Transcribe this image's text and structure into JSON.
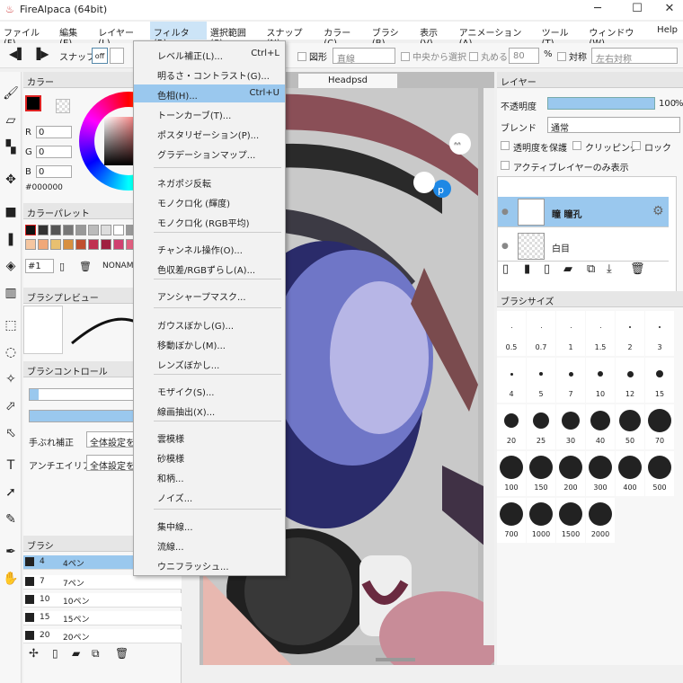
{
  "window": {
    "title": "FireAlpaca (64bit)",
    "min": "─",
    "max": "☐",
    "close": "✕"
  },
  "menubar": [
    "ファイル(F)",
    "編集(E)",
    "レイヤー(L)",
    "フィルタ(R)",
    "選択範囲(S)",
    "スナップ(N)",
    "カラー(C)",
    "ブラシ(B)",
    "表示(V)",
    "アニメーション(A)",
    "ツール(T)",
    "ウィンドウ(W)",
    "Help"
  ],
  "toolbar": {
    "snap": "スナップ",
    "off": "off",
    "shape_label": "図形",
    "shape_value": "直線",
    "center_label": "中央から選択",
    "round_label": "丸める",
    "round_value": "80",
    "percent": "%",
    "symmetry_label": "対称",
    "symmetry_value": "左右対称"
  },
  "filter_menu": [
    {
      "label": "レベル補正(L)...",
      "shortcut": "Ctrl+L"
    },
    {
      "label": "明るさ・コントラスト(G)...",
      "shortcut": ""
    },
    {
      "label": "色相(H)...",
      "shortcut": "Ctrl+U"
    },
    {
      "label": "トーンカーブ(T)...",
      "shortcut": ""
    },
    {
      "label": "ポスタリゼーション(P)...",
      "shortcut": ""
    },
    {
      "label": "グラデーションマップ...",
      "shortcut": ""
    },
    {
      "label": "ネガポジ反転",
      "shortcut": ""
    },
    {
      "label": "モノクロ化 (輝度)",
      "shortcut": ""
    },
    {
      "label": "モノクロ化 (RGB平均)",
      "shortcut": ""
    },
    {
      "label": "チャンネル操作(O)...",
      "shortcut": ""
    },
    {
      "label": "色収差/RGBずらし(A)...",
      "shortcut": ""
    },
    {
      "label": "アンシャープマスク...",
      "shortcut": ""
    },
    {
      "label": "ガウスぼかし(G)...",
      "shortcut": ""
    },
    {
      "label": "移動ぼかし(M)...",
      "shortcut": ""
    },
    {
      "label": "レンズぼかし...",
      "shortcut": ""
    },
    {
      "label": "モザイク(S)...",
      "shortcut": ""
    },
    {
      "label": "線画抽出(X)...",
      "shortcut": ""
    },
    {
      "label": "雲模様",
      "shortcut": ""
    },
    {
      "label": "砂模様",
      "shortcut": ""
    },
    {
      "label": "和柄...",
      "shortcut": ""
    },
    {
      "label": "ノイズ...",
      "shortcut": ""
    },
    {
      "label": "集中線...",
      "shortcut": ""
    },
    {
      "label": "流線...",
      "shortcut": ""
    },
    {
      "label": "ウニフラッシュ...",
      "shortcut": ""
    }
  ],
  "color_panel": {
    "title": "カラー",
    "r_label": "R",
    "r": "0",
    "g_label": "G",
    "g": "0",
    "b_label": "B",
    "b": "0",
    "hex": "#000000"
  },
  "palette_panel": {
    "title": "カラーパレット",
    "number": "#1",
    "name": "NONAM"
  },
  "brush_preview": {
    "title": "ブラシプレビュー"
  },
  "brush_control": {
    "title": "ブラシコントロール",
    "stabilizer": "手ぶれ補正",
    "stabilizer_value": "全体設定を",
    "antialias": "アンチエイリアス",
    "antialias_value": "全体設定を"
  },
  "brush_panel": {
    "title": "ブラシ",
    "items": [
      {
        "size": "4",
        "name": "4ペン"
      },
      {
        "size": "7",
        "name": "7ペン"
      },
      {
        "size": "10",
        "name": "10ペン"
      },
      {
        "size": "15",
        "name": "15ペン"
      },
      {
        "size": "20",
        "name": "20ペン"
      }
    ]
  },
  "canvas": {
    "tab": "Headpsd"
  },
  "layer_panel": {
    "title": "レイヤー",
    "opacity_label": "不透明度",
    "opacity_value": "100",
    "opacity_unit": "%",
    "blend_label": "ブレンド",
    "blend_value": "通常",
    "protect": "透明度を保護",
    "clipping": "クリッピング",
    "lock": "ロック",
    "active_only": "アクティブレイヤーのみ表示",
    "layers": [
      {
        "name": "瞳 瞳孔"
      },
      {
        "name": "白目"
      }
    ]
  },
  "brush_size_panel": {
    "title": "ブラシサイズ",
    "sizes": [
      "0.5",
      "0.7",
      "1",
      "1.5",
      "2",
      "3",
      "4",
      "5",
      "7",
      "10",
      "12",
      "15",
      "20",
      "25",
      "30",
      "40",
      "50",
      "70",
      "100",
      "150",
      "200",
      "300",
      "400",
      "500",
      "700",
      "1000",
      "1500",
      "2000"
    ]
  }
}
